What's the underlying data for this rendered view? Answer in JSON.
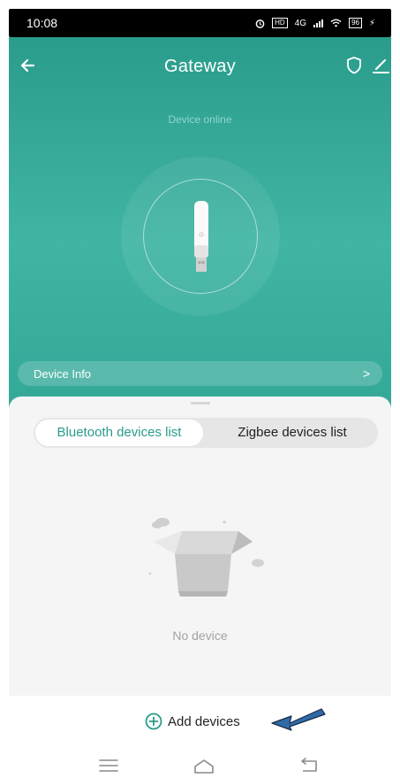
{
  "status_bar": {
    "time": "10:08",
    "hd_badge": "HD",
    "network": "4G",
    "battery": "96"
  },
  "header": {
    "title": "Gateway",
    "back_icon": "arrow-left-icon",
    "shield_icon": "shield-icon",
    "edit_icon": "pencil-icon"
  },
  "device": {
    "status": "Device online",
    "image_icon": "usb-dongle-icon"
  },
  "device_info": {
    "label": "Device Info",
    "chevron": ">"
  },
  "tabs": [
    {
      "label": "Bluetooth devices list",
      "active": true
    },
    {
      "label": "Zigbee devices list",
      "active": false
    }
  ],
  "empty_state": {
    "icon": "empty-box-icon",
    "text": "No device"
  },
  "footer": {
    "add_label": "Add devices",
    "add_icon": "plus-circle-icon"
  },
  "nav_bar": {
    "menu_icon": "menu-icon",
    "home_icon": "home-icon",
    "back_icon": "back-icon"
  },
  "colors": {
    "accent": "#2a9c8c",
    "hero_light": "#41b5a3",
    "sheet_bg": "#f5f5f5",
    "annotation_arrow": "#2f6aa5"
  }
}
